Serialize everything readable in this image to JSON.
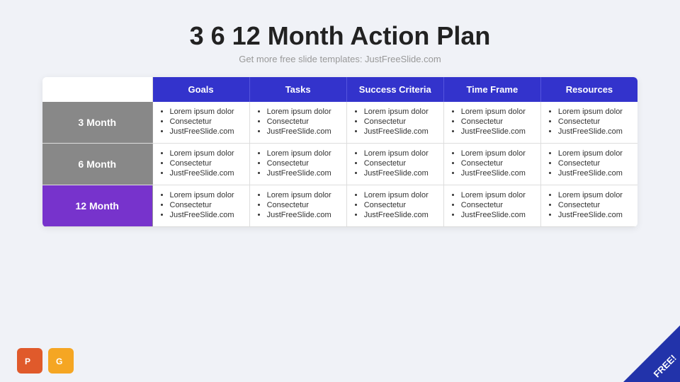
{
  "title": "3 6 12 Month Action Plan",
  "subtitle": "Get more free slide templates: JustFreeSlide.com",
  "table": {
    "headers": [
      "",
      "Goals",
      "Tasks",
      "Success Criteria",
      "Time Frame",
      "Resources"
    ],
    "rows": [
      {
        "label": "3 Month",
        "labelColor": "#888888",
        "cells": [
          [
            "Lorem ipsum dolor",
            "Consectetur",
            "JustFreeSlide.com"
          ],
          [
            "Lorem ipsum dolor",
            "Consectetur",
            "JustFreeSlide.com"
          ],
          [
            "Lorem ipsum dolor",
            "Consectetur",
            "JustFreeSlide.com"
          ],
          [
            "Lorem ipsum dolor",
            "Consectetur",
            "JustFreeSlide.com"
          ],
          [
            "Lorem ipsum dolor",
            "Consectetur",
            "JustFreeSlide.com"
          ]
        ]
      },
      {
        "label": "6 Month",
        "labelColor": "#888888",
        "cells": [
          [
            "Lorem ipsum dolor",
            "Consectetur",
            "JustFreeSlide.com"
          ],
          [
            "Lorem ipsum dolor",
            "Consectetur",
            "JustFreeSlide.com"
          ],
          [
            "Lorem ipsum dolor",
            "Consectetur",
            "JustFreeSlide.com"
          ],
          [
            "Lorem ipsum dolor",
            "Consectetur",
            "JustFreeSlide.com"
          ],
          [
            "Lorem ipsum dolor",
            "Consectetur",
            "JustFreeSlide.com"
          ]
        ]
      },
      {
        "label": "12 Month",
        "labelColor": "#7733cc",
        "cells": [
          [
            "Lorem ipsum dolor",
            "Consectetur",
            "JustFreeSlide.com"
          ],
          [
            "Lorem ipsum dolor",
            "Consectetur",
            "JustFreeSlide.com"
          ],
          [
            "Lorem ipsum dolor",
            "Consectetur",
            "JustFreeSlide.com"
          ],
          [
            "Lorem ipsum dolor",
            "Consectetur",
            "JustFreeSlide.com"
          ],
          [
            "Lorem ipsum dolor",
            "Consectetur",
            "JustFreeSlide.com"
          ]
        ]
      }
    ]
  },
  "free_badge": "FREE!",
  "icons": {
    "ppt": "P",
    "gslides": "G"
  }
}
